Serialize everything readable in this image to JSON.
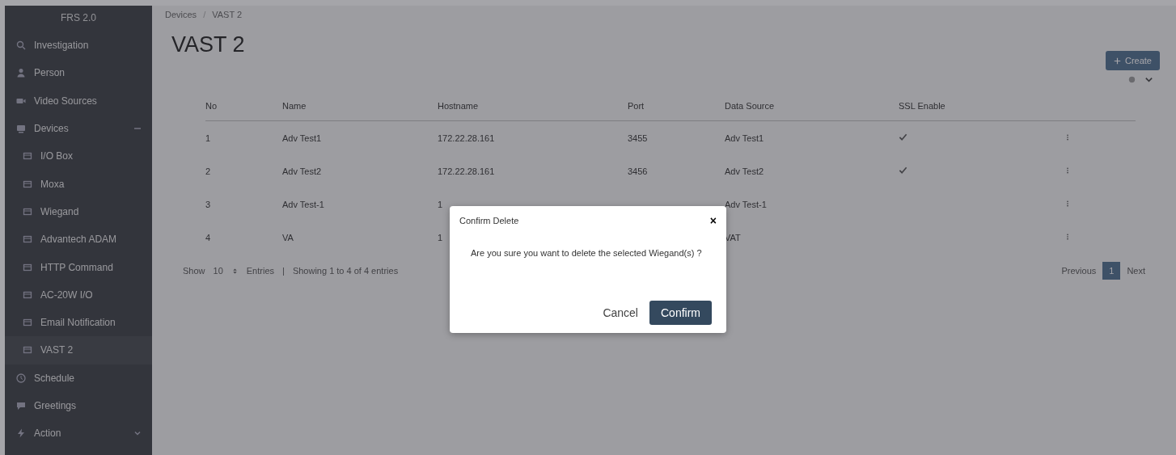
{
  "sidebar": {
    "title": "FRS 2.0",
    "items": [
      {
        "label": "Investigation",
        "kind": "search"
      },
      {
        "label": "Person",
        "kind": "person"
      },
      {
        "label": "Video Sources",
        "kind": "video"
      },
      {
        "label": "Devices",
        "kind": "device",
        "expanded": true,
        "children": [
          {
            "label": "I/O Box",
            "kind": "box",
            "selected": false
          },
          {
            "label": "Moxa",
            "kind": "box",
            "selected": false
          },
          {
            "label": "Wiegand",
            "kind": "box",
            "selected": false
          },
          {
            "label": "Advantech ADAM",
            "kind": "box",
            "selected": false
          },
          {
            "label": "HTTP Command",
            "kind": "box",
            "selected": false
          },
          {
            "label": "AC-20W I/O",
            "kind": "box",
            "selected": false
          },
          {
            "label": "Email Notification",
            "kind": "box",
            "selected": false
          },
          {
            "label": "VAST 2",
            "kind": "box",
            "selected": true
          }
        ]
      },
      {
        "label": "Schedule",
        "kind": "clock"
      },
      {
        "label": "Greetings",
        "kind": "chat"
      },
      {
        "label": "Action",
        "kind": "bolt",
        "expanded": false
      }
    ]
  },
  "breadcrumb": {
    "items": [
      "Devices",
      "VAST 2"
    ],
    "separator": "/"
  },
  "page_title": "VAST 2",
  "create_button": "Create",
  "table": {
    "columns": [
      "No",
      "Name",
      "Hostname",
      "Port",
      "Data Source",
      "SSL Enable"
    ],
    "rows": [
      {
        "cells": [
          "1",
          "Adv Test1",
          "172.22.28.161",
          "3455",
          "Adv Test1"
        ],
        "ssl": true
      },
      {
        "cells": [
          "2",
          "Adv Test2",
          "172.22.28.161",
          "3456",
          "Adv Test2"
        ],
        "ssl": true
      },
      {
        "cells": [
          "3",
          "Adv Test-1",
          "1",
          "",
          "Adv Test-1"
        ],
        "ssl": false
      },
      {
        "cells": [
          "4",
          "VA",
          "1",
          "",
          "VAT"
        ],
        "ssl": false
      }
    ]
  },
  "footer": {
    "show": "Show",
    "page_size": "10",
    "entries": "Entries",
    "divider": "|",
    "summary": "Showing 1 to 4 of 4 entries"
  },
  "pagination": {
    "previous": "Previous",
    "pages": [
      {
        "label": "1",
        "selected": true
      }
    ],
    "next": "Next"
  },
  "modal": {
    "title": "Confirm Delete",
    "close": "×",
    "message": "Are you sure you want to delete the selected Wiegand(s) ?",
    "cancel": "Cancel",
    "confirm": "Confirm"
  }
}
